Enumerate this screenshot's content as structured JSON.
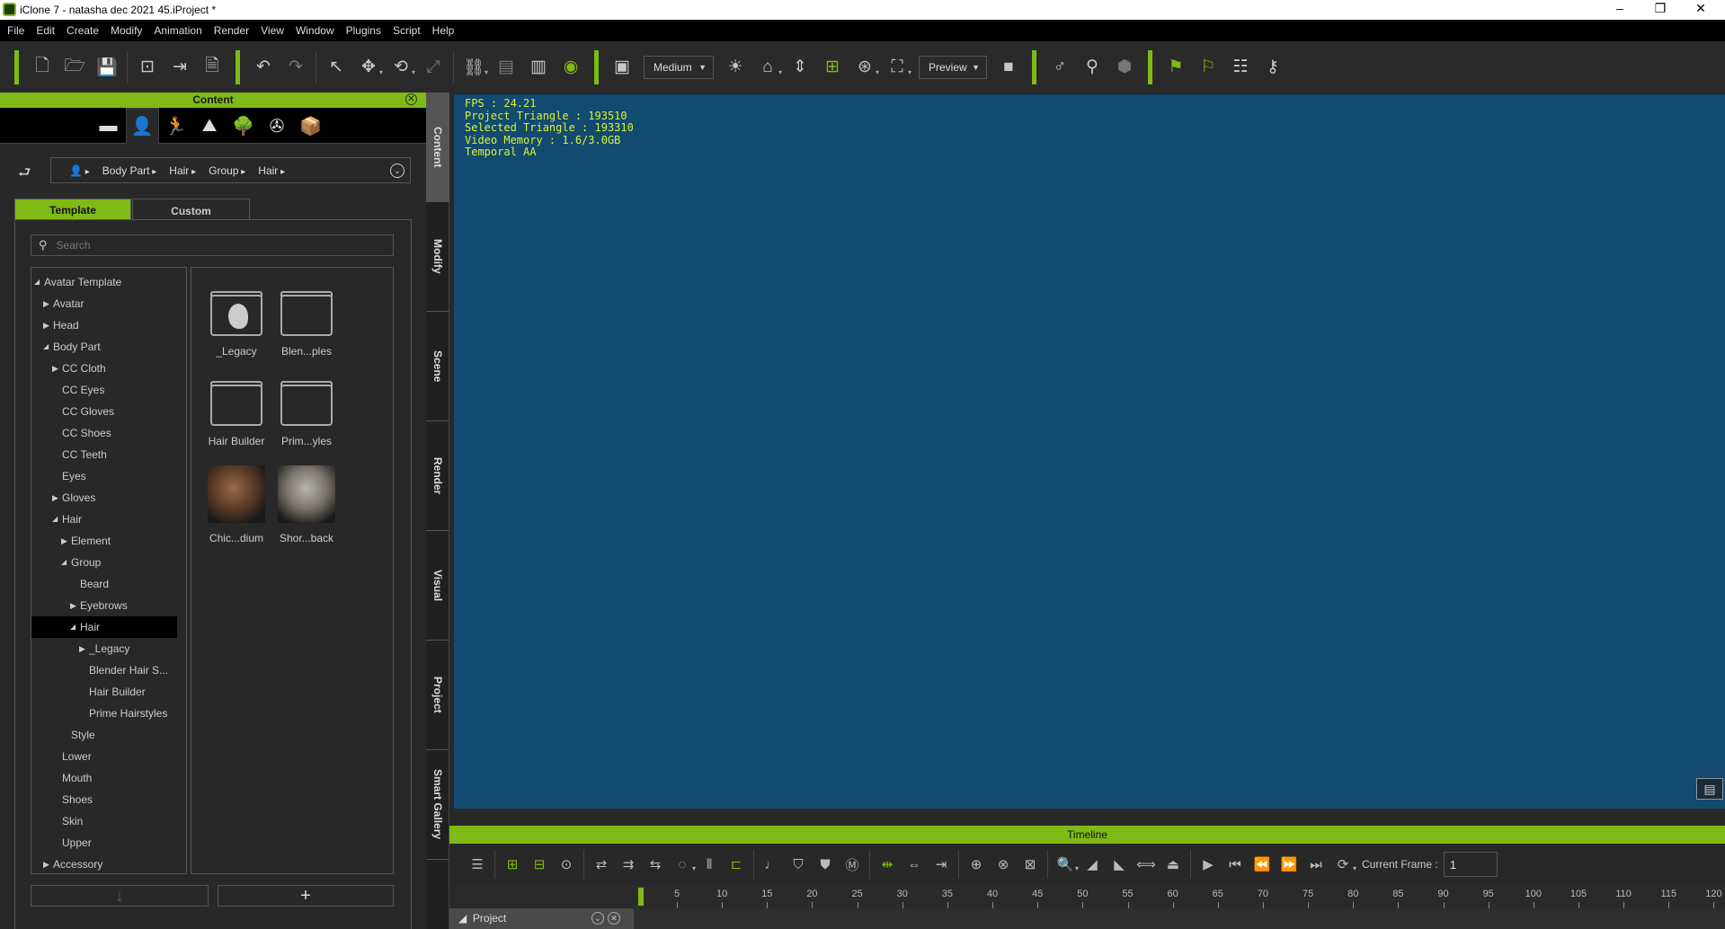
{
  "window": {
    "title": "iClone 7 - natasha dec 2021 45.iProject *",
    "controls": [
      "–",
      "❐",
      "✕"
    ]
  },
  "menu": [
    "File",
    "Edit",
    "Create",
    "Modify",
    "Animation",
    "Render",
    "View",
    "Window",
    "Plugins",
    "Script",
    "Help"
  ],
  "toolbar": {
    "items": [
      {
        "t": "gsep"
      },
      {
        "t": "btn",
        "icon": "new-file-icon",
        "g": "🗋"
      },
      {
        "t": "btn",
        "icon": "open-folder-icon",
        "g": "🗁"
      },
      {
        "t": "btn",
        "icon": "save-icon",
        "g": "💾"
      },
      {
        "t": "sep"
      },
      {
        "t": "btn",
        "icon": "import-icon",
        "g": "⊡"
      },
      {
        "t": "btn",
        "icon": "export-icon",
        "g": "⇥"
      },
      {
        "t": "btn",
        "icon": "usd-export-icon",
        "g": "🗎"
      },
      {
        "t": "gsep"
      },
      {
        "t": "btn",
        "icon": "undo-icon",
        "g": "↶"
      },
      {
        "t": "btn",
        "icon": "redo-icon",
        "g": "↷",
        "dim": true
      },
      {
        "t": "sep"
      },
      {
        "t": "btn",
        "icon": "select-arrow-icon",
        "g": "↖"
      },
      {
        "t": "btn",
        "icon": "move-icon",
        "g": "✥",
        "drop": true
      },
      {
        "t": "btn",
        "icon": "rotate-icon",
        "g": "⟲",
        "drop": true
      },
      {
        "t": "btn",
        "icon": "scale-icon",
        "g": "⤢",
        "dim": true
      },
      {
        "t": "sep"
      },
      {
        "t": "btn",
        "icon": "link-icon",
        "g": "⛓",
        "drop": true
      },
      {
        "t": "btn",
        "icon": "align-icon",
        "g": "▤",
        "dim": true
      },
      {
        "t": "btn",
        "icon": "align-to-icon",
        "g": "▥"
      },
      {
        "t": "btn",
        "icon": "visibility-eye-icon",
        "g": "◉",
        "green": true
      },
      {
        "t": "gsep"
      },
      {
        "t": "btn",
        "icon": "viewport-layout-icon",
        "g": "▣"
      },
      {
        "t": "dd",
        "label": "Medium",
        "w": 78
      },
      {
        "t": "btn",
        "icon": "light-icon",
        "g": "☀"
      },
      {
        "t": "btn",
        "icon": "home-camera-icon",
        "g": "⌂",
        "drop": true
      },
      {
        "t": "btn",
        "icon": "fit-vertical-icon",
        "g": "⇕"
      },
      {
        "t": "btn",
        "icon": "gizmo-move-icon",
        "g": "⊞",
        "green": true
      },
      {
        "t": "btn",
        "icon": "camera-rotate-icon",
        "g": "⊛",
        "drop": true
      },
      {
        "t": "btn",
        "icon": "frame-object-icon",
        "g": "⛶",
        "drop": true
      },
      {
        "t": "dd",
        "label": "Preview",
        "w": 76
      },
      {
        "t": "btn",
        "icon": "video-camera-icon",
        "g": "■"
      },
      {
        "t": "gsep"
      },
      {
        "t": "btn",
        "icon": "pose-bone-icon",
        "g": "♂"
      },
      {
        "t": "btn",
        "icon": "pose-view-icon",
        "g": "⚲"
      },
      {
        "t": "btn",
        "icon": "cubes-icon",
        "g": "⬢",
        "dim": true
      },
      {
        "t": "gsep"
      },
      {
        "t": "btn",
        "icon": "motion-puppet-icon",
        "g": "⚑",
        "green": true
      },
      {
        "t": "btn",
        "icon": "flag-icon",
        "g": "⚐",
        "green": true
      },
      {
        "t": "btn",
        "icon": "checklist-icon",
        "g": "☷"
      },
      {
        "t": "btn",
        "icon": "probe-icon",
        "g": "⚷"
      }
    ]
  },
  "content": {
    "title": "Content",
    "category_tabs": [
      {
        "icon": "folder-icon",
        "g": "▬"
      },
      {
        "icon": "avatar-icon",
        "g": "👤",
        "active": true
      },
      {
        "icon": "motion-icon",
        "g": "🏃"
      },
      {
        "icon": "stage-icon",
        "g": "⛰"
      },
      {
        "icon": "prop-tree-icon",
        "g": "🌳"
      },
      {
        "icon": "film-reel-icon",
        "g": "✇"
      },
      {
        "icon": "package-box-icon",
        "g": "📦"
      }
    ],
    "breadcrumb": [
      "Body Part",
      "Hair",
      "Group",
      "Hair"
    ],
    "tabs": {
      "template": "Template",
      "custom": "Custom"
    },
    "search_placeholder": "Search",
    "tree": [
      {
        "label": "Avatar Template",
        "lv": 0,
        "s": "open"
      },
      {
        "label": "Avatar",
        "lv": 1,
        "s": "closed"
      },
      {
        "label": "Head",
        "lv": 1,
        "s": "closed"
      },
      {
        "label": "Body Part",
        "lv": 1,
        "s": "open"
      },
      {
        "label": "CC Cloth",
        "lv": 2,
        "s": "closed"
      },
      {
        "label": "CC Eyes",
        "lv": 2
      },
      {
        "label": "CC Gloves",
        "lv": 2
      },
      {
        "label": "CC Shoes",
        "lv": 2
      },
      {
        "label": "CC Teeth",
        "lv": 2
      },
      {
        "label": "Eyes",
        "lv": 2
      },
      {
        "label": "Gloves",
        "lv": 2,
        "s": "closed"
      },
      {
        "label": "Hair",
        "lv": 2,
        "s": "open"
      },
      {
        "label": "Element",
        "lv": 3,
        "s": "closed"
      },
      {
        "label": "Group",
        "lv": 3,
        "s": "open"
      },
      {
        "label": "Beard",
        "lv": 4
      },
      {
        "label": "Eyebrows",
        "lv": 4,
        "s": "closed"
      },
      {
        "label": "Hair",
        "lv": 4,
        "s": "open",
        "selected": true
      },
      {
        "label": "_Legacy",
        "lv": 5,
        "s": "closed"
      },
      {
        "label": "Blender Hair S...",
        "lv": 5
      },
      {
        "label": "Hair Builder",
        "lv": 5
      },
      {
        "label": "Prime Hairstyles",
        "lv": 5
      },
      {
        "label": "Style",
        "lv": 3
      },
      {
        "label": "Lower",
        "lv": 2
      },
      {
        "label": "Mouth",
        "lv": 2
      },
      {
        "label": "Shoes",
        "lv": 2
      },
      {
        "label": "Skin",
        "lv": 2
      },
      {
        "label": "Upper",
        "lv": 2
      },
      {
        "label": "Accessory",
        "lv": 1,
        "s": "closed"
      }
    ],
    "grid": [
      {
        "label": "_Legacy",
        "kind": "folder-legacy"
      },
      {
        "label": "Blen...ples",
        "kind": "folder"
      },
      {
        "label": "Hair Builder",
        "kind": "folder"
      },
      {
        "label": "Prim...yles",
        "kind": "folder"
      },
      {
        "label": "Chic...dium",
        "kind": "thumb-female"
      },
      {
        "label": "Shor...back",
        "kind": "thumb-male"
      }
    ],
    "bottom_buttons": [
      {
        "icon": "download-arrow-icon",
        "g": "↓"
      },
      {
        "icon": "add-plus-icon",
        "g": "+"
      }
    ]
  },
  "side_tabs": [
    "Content",
    "Modify",
    "Scene",
    "Render",
    "Visual",
    "Project",
    "Smart Gallery"
  ],
  "viewport": {
    "stats": [
      "FPS : 24.21",
      "Project Triangle : 193510",
      "Selected Triangle : 193310",
      "Video Memory : 1.6/3.0GB",
      "Temporal AA"
    ]
  },
  "timeline": {
    "title": "Timeline",
    "tools": [
      {
        "icon": "track-list-icon",
        "g": "☰"
      },
      {
        "t": "sep"
      },
      {
        "icon": "add-key-icon",
        "g": "⊞",
        "green": true
      },
      {
        "icon": "layer-key-icon",
        "g": "⊟",
        "green": true
      },
      {
        "icon": "eye-list-icon",
        "g": "⊙"
      },
      {
        "t": "sep"
      },
      {
        "icon": "loop-icon",
        "g": "⇄"
      },
      {
        "icon": "insert-icon",
        "g": "⇉"
      },
      {
        "icon": "shift-icon",
        "g": "⇆"
      },
      {
        "icon": "transition-icon",
        "g": "◌",
        "drop": true
      },
      {
        "icon": "split-icon",
        "g": "⫴"
      },
      {
        "icon": "range-icon",
        "g": "⊏",
        "green": true
      },
      {
        "t": "sep"
      },
      {
        "icon": "sound-icon",
        "g": "♩"
      },
      {
        "icon": "add-motion-icon",
        "g": "⛉"
      },
      {
        "icon": "remove-motion-icon",
        "g": "⛊"
      },
      {
        "icon": "m-icon",
        "g": "Ⓜ"
      },
      {
        "t": "sep"
      },
      {
        "icon": "fit-range-icon",
        "g": "⇹",
        "green": true
      },
      {
        "icon": "stretch-icon",
        "g": "⇔"
      },
      {
        "icon": "jump-range-icon",
        "g": "⇥"
      },
      {
        "t": "sep"
      },
      {
        "icon": "add-marker-icon",
        "g": "⊕"
      },
      {
        "icon": "remove-marker-icon",
        "g": "⊗"
      },
      {
        "icon": "marker-list-icon",
        "g": "⊠"
      },
      {
        "t": "sep"
      },
      {
        "icon": "zoom-icon",
        "g": "🔍",
        "drop": true
      },
      {
        "icon": "shrink-left-icon",
        "g": "◢"
      },
      {
        "icon": "shrink-right-icon",
        "g": "◣"
      },
      {
        "icon": "fit-icon",
        "g": "⟺"
      },
      {
        "icon": "export-clip-icon",
        "g": "⏏"
      },
      {
        "t": "sep"
      },
      {
        "icon": "play-icon",
        "g": "▶"
      },
      {
        "icon": "first-frame-icon",
        "g": "⏮"
      },
      {
        "icon": "previous-frame-icon",
        "g": "⏪"
      },
      {
        "icon": "next-frame-icon",
        "g": "⏩"
      },
      {
        "icon": "last-frame-icon",
        "g": "⏭"
      },
      {
        "icon": "loop-mode-icon",
        "g": "⟳",
        "drop": true
      }
    ],
    "current_frame_label": "Current Frame :",
    "current_frame": "1",
    "ruler_ticks": [
      5,
      10,
      15,
      20,
      25,
      30,
      35,
      40,
      45,
      50,
      55,
      60,
      65,
      70,
      75,
      80,
      85,
      90,
      95,
      100,
      105,
      110,
      115,
      120
    ],
    "track": "Project"
  },
  "colors": {
    "accent": "#7fba16",
    "viewport": "#134a70",
    "stats_text": "#d6f23a"
  }
}
